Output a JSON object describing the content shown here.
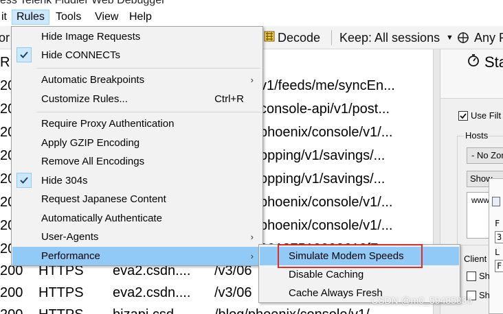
{
  "window": {
    "title": "ess Telerik Fiddler Web Debugger"
  },
  "menubar": {
    "items": [
      "it",
      "Rules",
      "Tools",
      "View",
      "Help"
    ]
  },
  "toolbar": {
    "left_fragment": "or",
    "decode_label": "Decode",
    "keep_label": "Keep: All sessions",
    "any_label": "Any P"
  },
  "sessions": {
    "header_fragment": "R",
    "rows": [
      {
        "result": "20",
        "url": "v1/feeds/me/syncEn..."
      },
      {
        "result": "20",
        "url": "console-api/v1/post..."
      },
      {
        "result": "20",
        "url": "phoenix/console/v1/..."
      },
      {
        "result": "20",
        "url": "opping/v1/savings/..."
      },
      {
        "result": "20",
        "url": "opping/v1/savings/..."
      },
      {
        "result": "20",
        "url": "phoenix/console/v1/..."
      },
      {
        "result": "20",
        "url": "phoenix/console/v1/..."
      },
      {
        "result": "20",
        "url": "00137510002612f7..."
      },
      {
        "result": "200",
        "protocol": "HTTPS",
        "host": "eva2.csdn....",
        "url": "/v3/06"
      },
      {
        "result": "200",
        "protocol": "HTTPS",
        "host": "eva2.csdn....",
        "url": "/v3/06"
      },
      {
        "result": "200",
        "protocol": "HTTPS",
        "host": "bizapi.csd...",
        "url": "/blog/phoenix/console/v1/..."
      }
    ]
  },
  "right_panel": {
    "tab_label": "Sta",
    "use_filters_label": "Use Filt",
    "hosts_label": "Hosts",
    "zone_select": "- No Zon",
    "show_select": "Show",
    "hosts_textarea": "www.",
    "client_label": "Client",
    "sh1": "Sh",
    "sh2": "Sh",
    "side_f": "F",
    "side_3": "3",
    "side_l": "L",
    "side_f2": "F"
  },
  "rules_menu": {
    "items": [
      {
        "label": "Hide Image Requests",
        "checked": false
      },
      {
        "label": "Hide CONNECTs",
        "checked": true
      },
      {
        "label": "Automatic Breakpoints",
        "submenu": true
      },
      {
        "label": "Customize Rules...",
        "shortcut": "Ctrl+R"
      },
      {
        "label": "Require Proxy Authentication"
      },
      {
        "label": "Apply GZIP Encoding"
      },
      {
        "label": "Remove All Encodings"
      },
      {
        "label": "Hide 304s",
        "checked": true
      },
      {
        "label": "Request Japanese Content"
      },
      {
        "label": "Automatically Authenticate"
      },
      {
        "label": "User-Agents",
        "submenu": true
      },
      {
        "label": "Performance",
        "submenu": true,
        "highlighted": true
      }
    ]
  },
  "performance_submenu": {
    "items": [
      {
        "label": "Simulate Modem Speeds",
        "highlighted": true
      },
      {
        "label": "Disable Caching"
      },
      {
        "label": "Cache Always Fresh"
      }
    ]
  },
  "watermark": "CSDN @m0_59485836",
  "colors": {
    "menu_highlight": "#91c9f7",
    "check_bg": "#cce8ff",
    "annotation_red": "#e02b2b"
  }
}
